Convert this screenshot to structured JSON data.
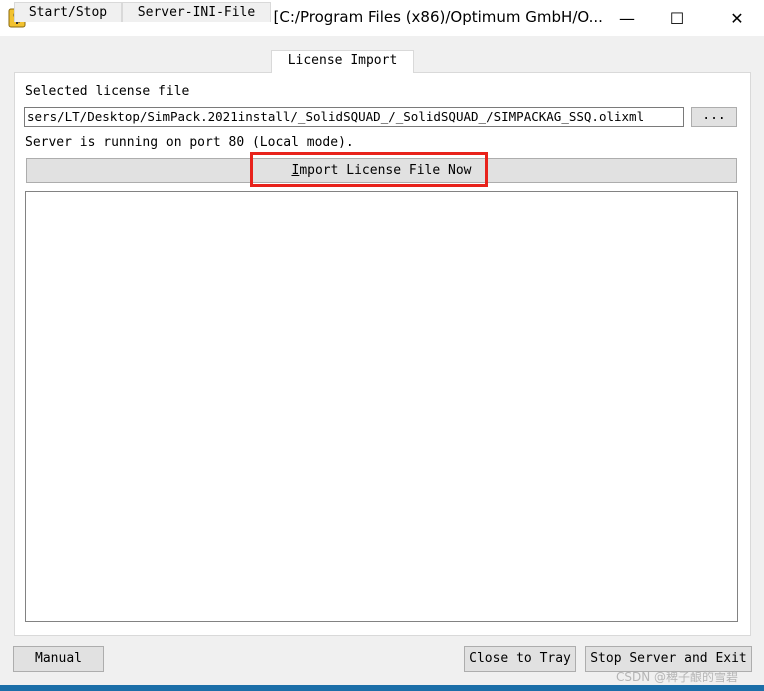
{
  "window": {
    "title": "OLicense-Server-Control 4.9.0 - [C:/Program Files (x86)/Optimum GmbH/O...",
    "icon": "key-lock-icon",
    "controls": {
      "minimize": "—",
      "maximize": "☐",
      "close": "✕"
    }
  },
  "tabs": [
    {
      "label": "Start/Stop",
      "active": false
    },
    {
      "label": "Server-INI-File",
      "active": false
    },
    {
      "label": "License Import",
      "active": true
    }
  ],
  "license_import": {
    "selected_label": "Selected license file",
    "file_path": "sers/LT/Desktop/SimPack.2021install/_SolidSQUAD_/_SolidSQUAD_/SIMPACKAG_SSQ.olixml",
    "browse_label": "...",
    "status": "Server is running on port 80 (Local mode).",
    "import_button": {
      "mnemonic": "I",
      "rest": "mport License File Now"
    },
    "log": ""
  },
  "footer": {
    "manual_label": "Manual",
    "close_tray_label": "Close to Tray",
    "stop_exit_label": "Stop Server and Exit"
  },
  "watermark": "CSDN @稗子酿的雪碧",
  "colors": {
    "highlight": "#e8221b",
    "taskbar": "#1b6ea8"
  }
}
